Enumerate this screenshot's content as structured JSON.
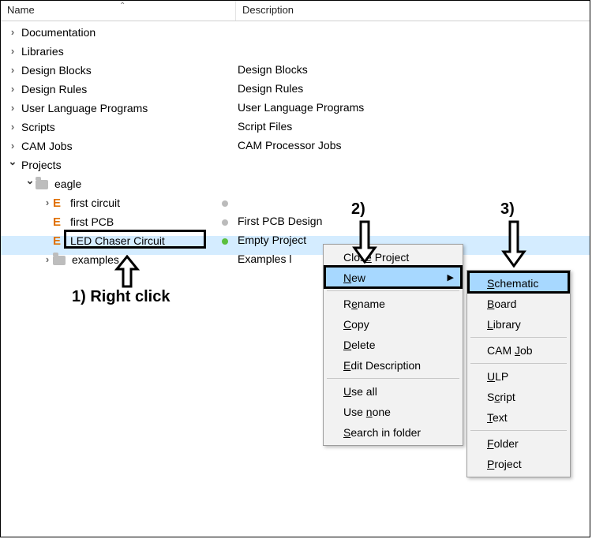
{
  "header": {
    "name": "Name",
    "description": "Description"
  },
  "tree": {
    "documentation": "Documentation",
    "libraries": "Libraries",
    "design_blocks": {
      "label": "Design Blocks",
      "desc": "Design Blocks"
    },
    "design_rules": {
      "label": "Design Rules",
      "desc": "Design Rules"
    },
    "ulp": {
      "label": "User Language Programs",
      "desc": "User Language Programs"
    },
    "scripts": {
      "label": "Scripts",
      "desc": "Script Files"
    },
    "cam_jobs": {
      "label": "CAM Jobs",
      "desc": "CAM Processor Jobs"
    },
    "projects": "Projects",
    "eagle": "eagle",
    "first_circuit": "first circuit",
    "first_pcb": {
      "label": "first PCB",
      "desc": "First PCB Design"
    },
    "led_chaser": {
      "label": "LED Chaser Circuit",
      "desc": "Empty Project"
    },
    "examples": {
      "label": "examples",
      "desc": "Examples l"
    }
  },
  "ctx1": {
    "close_project": "Close Project",
    "new": "New",
    "rename": "Rename",
    "copy": "Copy",
    "delete": "Delete",
    "edit_description": "Edit Description",
    "use_all": "Use all",
    "use_none": "Use none",
    "search_in_folder": "Search in folder"
  },
  "ctx2": {
    "schematic": "Schematic",
    "board": "Board",
    "library": "Library",
    "cam_job": "CAM Job",
    "ulp": "ULP",
    "script": "Script",
    "text": "Text",
    "folder": "Folder",
    "project": "Project"
  },
  "annotations": {
    "step1": "1) Right click",
    "step2": "2)",
    "step3": "3)"
  }
}
